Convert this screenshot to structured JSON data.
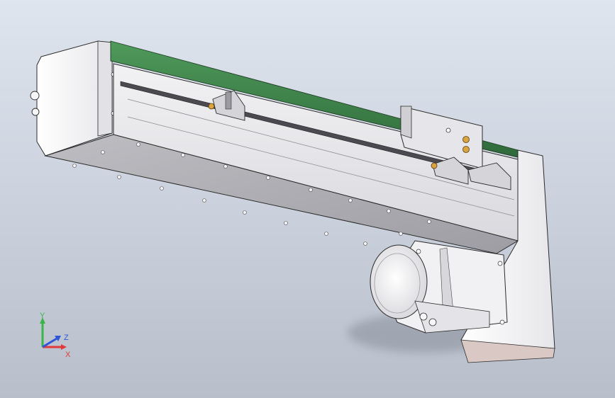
{
  "viewport": {
    "background_top": "#dfe5ee",
    "background_bottom": "#b8bfcb"
  },
  "model": {
    "body_color": "#e9e9ec",
    "belt_color": "#3f7d4a",
    "edge_color": "#2b2b2b",
    "motor_color": "#f3f3f5",
    "fastener_color": "#d9a441"
  },
  "triad": {
    "x_label": "X",
    "y_label": "Y",
    "z_label": "Z",
    "x_color": "#e03a3a",
    "y_color": "#3bb54a",
    "z_color": "#2f56d6"
  }
}
